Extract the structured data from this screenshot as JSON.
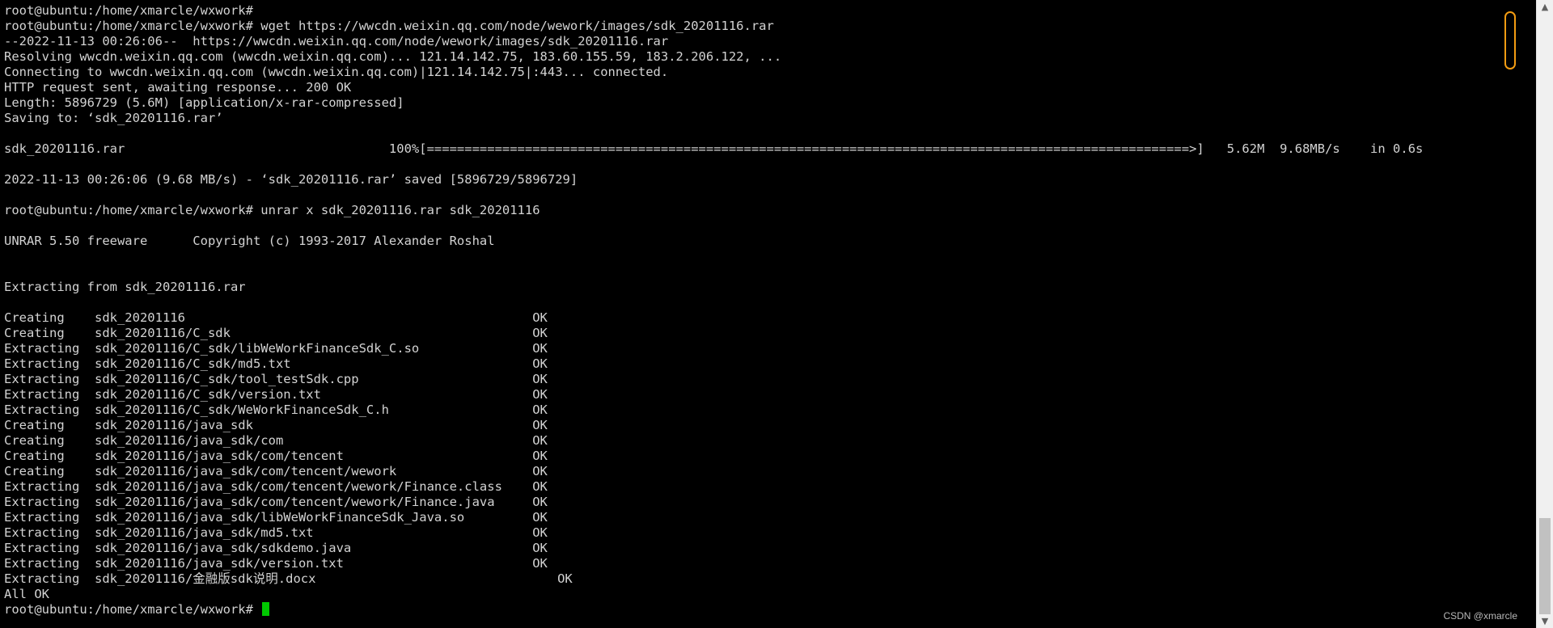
{
  "terminal": {
    "background": "#000000",
    "foreground": "#d3d3d3",
    "cursor_color": "#00c800",
    "lines": [
      "root@ubuntu:/home/xmarcle/wxwork#",
      "root@ubuntu:/home/xmarcle/wxwork# wget https://wwcdn.weixin.qq.com/node/wework/images/sdk_20201116.rar",
      "--2022-11-13 00:26:06--  https://wwcdn.weixin.qq.com/node/wework/images/sdk_20201116.rar",
      "Resolving wwcdn.weixin.qq.com (wwcdn.weixin.qq.com)... 121.14.142.75, 183.60.155.59, 183.2.206.122, ...",
      "Connecting to wwcdn.weixin.qq.com (wwcdn.weixin.qq.com)|121.14.142.75|:443... connected.",
      "HTTP request sent, awaiting response... 200 OK",
      "Length: 5896729 (5.6M) [application/x-rar-compressed]",
      "Saving to: ‘sdk_20201116.rar’",
      "",
      "sdk_20201116.rar                                   100%[=====================================================================================================>]   5.62M  9.68MB/s    in 0.6s",
      "",
      "2022-11-13 00:26:06 (9.68 MB/s) - ‘sdk_20201116.rar’ saved [5896729/5896729]",
      "",
      "root@ubuntu:/home/xmarcle/wxwork# unrar x sdk_20201116.rar sdk_20201116",
      "",
      "UNRAR 5.50 freeware      Copyright (c) 1993-2017 Alexander Roshal",
      "",
      "",
      "Extracting from sdk_20201116.rar",
      "",
      "Creating    sdk_20201116                                              OK",
      "Creating    sdk_20201116/C_sdk                                        OK",
      "Extracting  sdk_20201116/C_sdk/libWeWorkFinanceSdk_C.so               OK",
      "Extracting  sdk_20201116/C_sdk/md5.txt                                OK",
      "Extracting  sdk_20201116/C_sdk/tool_testSdk.cpp                       OK",
      "Extracting  sdk_20201116/C_sdk/version.txt                            OK",
      "Extracting  sdk_20201116/C_sdk/WeWorkFinanceSdk_C.h                   OK",
      "Creating    sdk_20201116/java_sdk                                     OK",
      "Creating    sdk_20201116/java_sdk/com                                 OK",
      "Creating    sdk_20201116/java_sdk/com/tencent                         OK",
      "Creating    sdk_20201116/java_sdk/com/tencent/wework                  OK",
      "Extracting  sdk_20201116/java_sdk/com/tencent/wework/Finance.class    OK",
      "Extracting  sdk_20201116/java_sdk/com/tencent/wework/Finance.java     OK",
      "Extracting  sdk_20201116/java_sdk/libWeWorkFinanceSdk_Java.so         OK",
      "Extracting  sdk_20201116/java_sdk/md5.txt                             OK",
      "Extracting  sdk_20201116/java_sdk/sdkdemo.java                        OK",
      "Extracting  sdk_20201116/java_sdk/version.txt                         OK",
      "Extracting  sdk_20201116/金融版sdk说明.docx                                OK",
      "All OK"
    ],
    "prompt_line": "root@ubuntu:/home/xmarcle/wxwork# "
  },
  "scrollbar": {
    "up_glyph": "▲",
    "down_glyph": "▼",
    "position_fraction": 1.0,
    "visible_fraction": 0.16
  },
  "watermark": {
    "text": "CSDN @xmarcle"
  },
  "colors": {
    "scrollbar_bg": "#f0f0f0",
    "scrollbar_thumb": "#c1c1c1",
    "status_accent": "#f39c12"
  }
}
